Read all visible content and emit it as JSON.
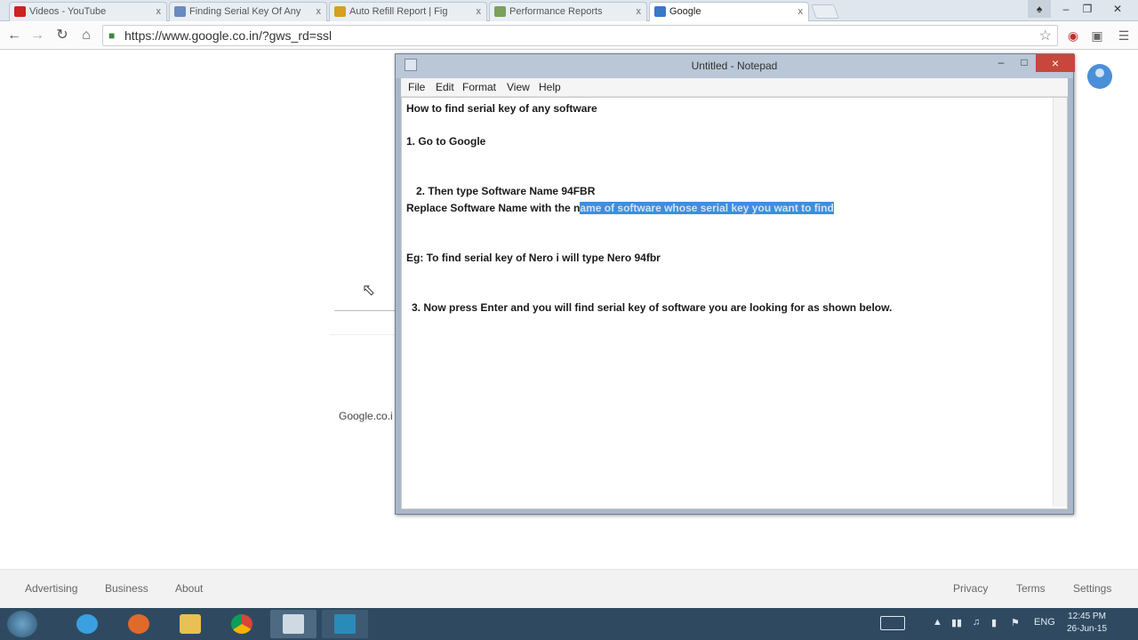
{
  "browser": {
    "tabs": [
      {
        "title": "Videos - YouTube",
        "active": false,
        "icon": "youtube-icon",
        "color": "#cc2222"
      },
      {
        "title": "Finding Serial Key Of Any",
        "active": false,
        "icon": "page-icon",
        "color": "#6a8bbf"
      },
      {
        "title": "Auto Refill Report | Fig",
        "active": false,
        "icon": "page-icon",
        "color": "#d4a020"
      },
      {
        "title": "Performance Reports",
        "active": false,
        "icon": "page-icon",
        "color": "#7aa05a"
      },
      {
        "title": "Google",
        "active": true,
        "icon": "google-icon",
        "color": "#3a78c8"
      }
    ],
    "tab_close": "x",
    "url": "https://www.google.co.in/?gws_rd=ssl"
  },
  "page": {
    "domain_label": "Google.co.i",
    "footer_left": [
      "Advertising",
      "Business",
      "About"
    ],
    "footer_right": [
      "Privacy",
      "Terms",
      "Settings"
    ]
  },
  "notepad": {
    "title": "Untitled - Notepad",
    "menu": [
      "File",
      "Edit",
      "Format",
      "View",
      "Help"
    ],
    "close_label": "×",
    "lines": {
      "l1": "How to find serial key of any software",
      "l2": "1. Go to Google",
      "l3": "2. Then type  Software Name 94FBR",
      "l4a": "Replace Software Name with the n",
      "l4b": "ame of software whose serial key you want to find",
      "l5": "Eg: To find serial key of Nero i will type Nero 94fbr",
      "l6": "3. Now press Enter and you will find serial key of software you are looking for as shown below."
    }
  },
  "taskbar": {
    "lang": "ENG",
    "time": "12:45 PM",
    "date": "26-Jun-15"
  }
}
